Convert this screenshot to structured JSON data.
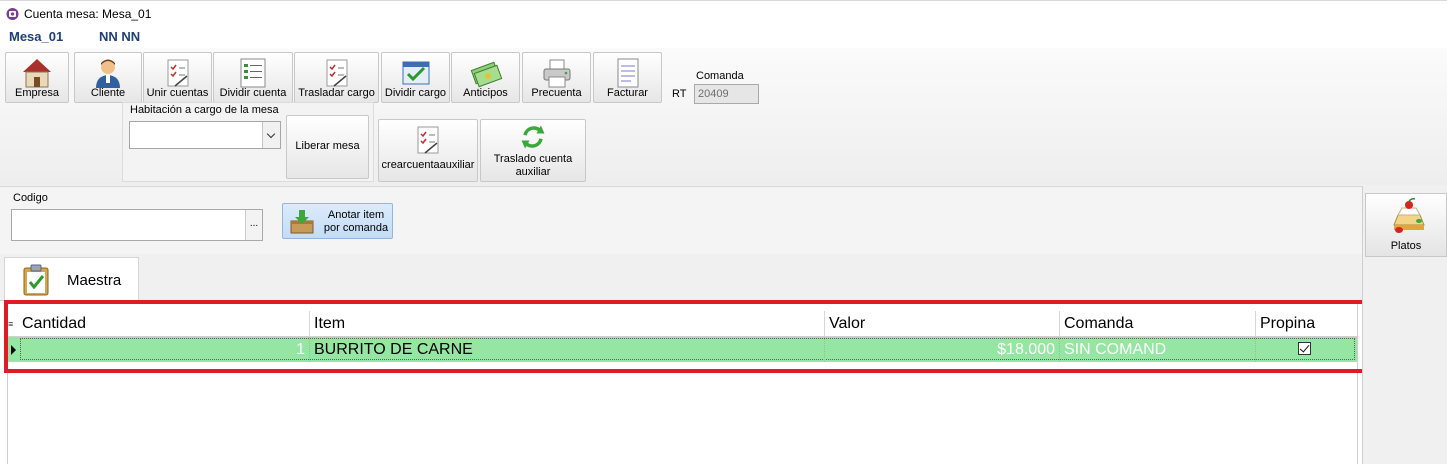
{
  "window": {
    "title": "Cuenta mesa: Mesa_01"
  },
  "header": {
    "mesa": "Mesa_01",
    "client": "NN NN"
  },
  "toolbar": {
    "buttons": [
      {
        "label": "Empresa",
        "icon": "house-icon"
      },
      {
        "label": "Cliente",
        "icon": "person-icon"
      },
      {
        "label": "Unir cuentas",
        "icon": "checklist-icon"
      },
      {
        "label": "Dividir cuenta",
        "icon": "list-icon"
      },
      {
        "label": "Trasladar cargo",
        "icon": "checklist-icon"
      },
      {
        "label": "Dividir cargo",
        "icon": "checkbox-icon"
      },
      {
        "label": "Anticipos",
        "icon": "money-icon"
      },
      {
        "label": "Precuenta",
        "icon": "printer-icon"
      },
      {
        "label": "Facturar",
        "icon": "document-icon"
      }
    ],
    "comanda_label": "Comanda",
    "rt_label": "RT",
    "comanda_value": "20409",
    "habitacion_label": "Habitación a cargo de la mesa",
    "habitacion_value": "",
    "liberar_label": "Liberar mesa",
    "crear_label": "crearcuentaauxiliar",
    "traslado_label": "Traslado cuenta auxiliar"
  },
  "codigo": {
    "label": "Codigo",
    "value": "",
    "dots": "...",
    "anotar_label": "Anotar item por comanda"
  },
  "tabs": [
    {
      "label": "Maestra"
    }
  ],
  "grid": {
    "columns": [
      "Cantidad",
      "Item",
      "Valor",
      "Comanda",
      "Propina"
    ],
    "rows": [
      {
        "cantidad": "1",
        "item": "BURRITO DE CARNE",
        "valor": "$18.000",
        "comanda": "SIN COMAND",
        "propina": true
      }
    ]
  },
  "right_panel": {
    "platos_label": "Platos"
  },
  "colors": {
    "row_selected": "#96e6a3",
    "highlight": "#e01b24",
    "header_text": "#1f3f7a"
  }
}
